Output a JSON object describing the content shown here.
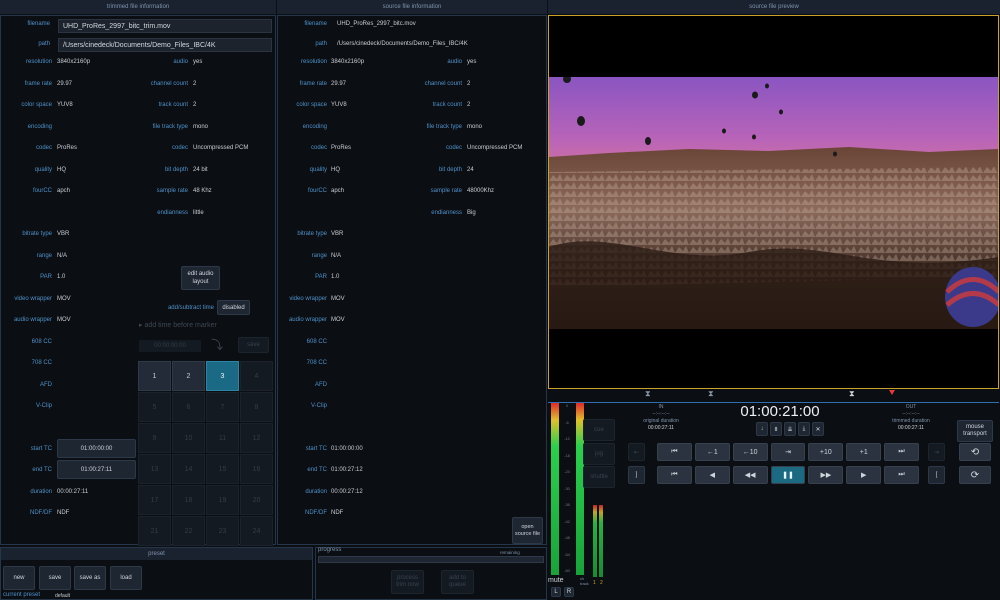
{
  "headers": {
    "trimmed": "trimmed file information",
    "source": "source file information",
    "preview": "source file preview"
  },
  "trimmed": {
    "filename_label": "filename",
    "filename": "UHD_ProRes_2997_bitc_trim.mov",
    "path_label": "path",
    "path": "/Users/cinedeck/Documents/Demo_Files_IBC/4K",
    "left_fields": [
      {
        "label": "resolution",
        "value": "3840x2160p"
      },
      {
        "label": "frame rate",
        "value": "29.97"
      },
      {
        "label": "color space",
        "value": "YUV8"
      },
      {
        "label": "encoding",
        "value": ""
      },
      {
        "label": "codec",
        "value": "ProRes"
      },
      {
        "label": "quality",
        "value": "HQ"
      },
      {
        "label": "fourCC",
        "value": "apch"
      },
      {
        "label": "",
        "value": ""
      },
      {
        "label": "bitrate type",
        "value": "VBR"
      },
      {
        "label": "range",
        "value": "N/A"
      },
      {
        "label": "PAR",
        "value": "1.0"
      },
      {
        "label": "video wrapper",
        "value": "MOV"
      },
      {
        "label": "audio wrapper",
        "value": "MOV"
      },
      {
        "label": "608 CC",
        "value": ""
      },
      {
        "label": "708 CC",
        "value": ""
      },
      {
        "label": "AFD",
        "value": ""
      },
      {
        "label": "V-Clip",
        "value": ""
      }
    ],
    "audio_fields": [
      {
        "label": "audio",
        "value": "yes"
      },
      {
        "label": "channel count",
        "value": "2"
      },
      {
        "label": "track count",
        "value": "2"
      },
      {
        "label": "file track type",
        "value": "mono"
      },
      {
        "label": "codec",
        "value": "Uncompressed PCM"
      },
      {
        "label": "bit depth",
        "value": "24 bit"
      },
      {
        "label": "sample rate",
        "value": "48 Khz"
      },
      {
        "label": "endianness",
        "value": "little"
      }
    ],
    "edit_audio_layout": "edit audio layout",
    "add_subtract_label": "add/subtract time",
    "add_subtract_value": "disabled",
    "add_time_before_marker": "add time before marker",
    "time_entry": "00:00:00:00",
    "save": "save",
    "keypad": [
      "1",
      "2",
      "3",
      "4",
      "5",
      "6",
      "7",
      "8",
      "9",
      "10",
      "11",
      "12",
      "13",
      "14",
      "15",
      "16",
      "17",
      "18",
      "19",
      "20",
      "21",
      "22",
      "23",
      "24"
    ],
    "start_tc_label": "start TC",
    "start_tc": "01:00:00:00",
    "end_tc_label": "end TC",
    "end_tc": "01:00:27:11",
    "duration_label": "duration",
    "duration": "00:00:27:11",
    "ndf_label": "NDF/DF",
    "ndf": "NDF"
  },
  "source": {
    "filename_label": "filename",
    "filename": "UHD_ProRes_2997_bitc.mov",
    "path_label": "path",
    "path": "/Users/cinedeck/Documents/Demo_Files_IBC/4K",
    "left_fields": [
      {
        "label": "resolution",
        "value": "3840x2160p"
      },
      {
        "label": "frame rate",
        "value": "29.97"
      },
      {
        "label": "color space",
        "value": "YUV8"
      },
      {
        "label": "encoding",
        "value": ""
      },
      {
        "label": "codec",
        "value": "ProRes"
      },
      {
        "label": "quality",
        "value": "HQ"
      },
      {
        "label": "fourCC",
        "value": "apch"
      },
      {
        "label": "",
        "value": ""
      },
      {
        "label": "bitrate type",
        "value": "VBR"
      },
      {
        "label": "range",
        "value": "N/A"
      },
      {
        "label": "PAR",
        "value": "1.0"
      },
      {
        "label": "video wrapper",
        "value": "MOV"
      },
      {
        "label": "audio wrapper",
        "value": "MOV"
      },
      {
        "label": "608 CC",
        "value": ""
      },
      {
        "label": "708 CC",
        "value": ""
      },
      {
        "label": "AFD",
        "value": ""
      },
      {
        "label": "V-Clip",
        "value": ""
      }
    ],
    "audio_fields": [
      {
        "label": "audio",
        "value": "yes"
      },
      {
        "label": "channel count",
        "value": "2"
      },
      {
        "label": "track count",
        "value": "2"
      },
      {
        "label": "file track type",
        "value": "mono"
      },
      {
        "label": "codec",
        "value": "Uncompressed PCM"
      },
      {
        "label": "bit depth",
        "value": "24"
      },
      {
        "label": "sample rate",
        "value": "48000Khz"
      },
      {
        "label": "endianness",
        "value": "Big"
      }
    ],
    "start_tc_label": "start TC",
    "start_tc": "01:00:00:00",
    "end_tc_label": "end TC",
    "end_tc": "01:00:27:12",
    "duration_label": "duration",
    "duration": "00:00:27:12",
    "ndf_label": "NDF/DF",
    "ndf": "NDF",
    "open_source_file": "open source file"
  },
  "preset": {
    "title": "preset",
    "new": "new",
    "save": "save",
    "save_as": "save as",
    "load": "load",
    "current_label": "current preset",
    "current_value": "default"
  },
  "progress": {
    "title": "progress",
    "remaining": "remaining",
    "process": "process trim now",
    "add_queue": "add to queue"
  },
  "transport": {
    "timecode": "01:00:21:00",
    "in_label": "IN",
    "in_tc": "--:--:--:--",
    "original_duration_label": "original duration",
    "original_duration": "00:00:27:11",
    "out_label": "OUT",
    "out_tc": "--:--:--:--",
    "trimmed_duration_label": "trimmed duration",
    "trimmed_duration": "00:00:27:11",
    "mouse_transport": "mouse transport",
    "cue": "cue",
    "jog": "jog",
    "shuttle": "shuttle",
    "row1": [
      "⏮",
      "←1",
      "←10",
      "⇥",
      "+10",
      "+1",
      "⏭"
    ],
    "row2": [
      "⏮",
      "◀",
      "◀◀",
      "❚❚",
      "▶▶",
      "▶",
      "⏭"
    ],
    "left_bracket": "]",
    "right_bracket": "[",
    "mute": "mute",
    "L": "L",
    "R": "R",
    "meter_ticks": [
      "0",
      "-6",
      "-12",
      "-18",
      "-24",
      "-30",
      "-36",
      "-42",
      "-48",
      "-54",
      "-60"
    ],
    "ch_label": "ch track",
    "ch_nums": [
      "1",
      "2"
    ]
  },
  "colors": {
    "accent": "#1a6a85",
    "label_blue": "#4f92c9",
    "preview_border": "#c9a227",
    "playhead": "#e03a3a"
  }
}
